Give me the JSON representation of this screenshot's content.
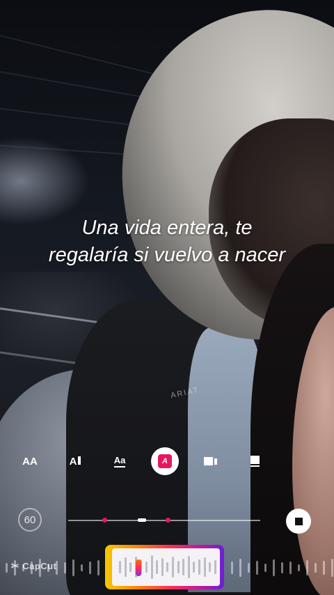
{
  "lyrics": {
    "line1": "Una vida entera, te",
    "line2": "regalaría si vuelvo a nacer"
  },
  "background": {
    "print_text": "ARIAT"
  },
  "toolbar": {
    "items": [
      {
        "id": "text-size",
        "label": "AA",
        "icon": "text-size-icon"
      },
      {
        "id": "text-style",
        "label": "A",
        "icon": "text-style-icon"
      },
      {
        "id": "text-underline",
        "label": "Aa",
        "icon": "text-underline-icon"
      },
      {
        "id": "text-color",
        "label": "A",
        "icon": "text-color-icon",
        "active": true
      },
      {
        "id": "background-style",
        "icon": "background-style-icon"
      },
      {
        "id": "placement",
        "icon": "placement-icon"
      }
    ],
    "accent_color": "#e8175d"
  },
  "timeline": {
    "speed_label": "60",
    "stop_icon": "stop-icon"
  },
  "scrubber": {
    "gradient_colors": [
      "#f7c900",
      "#ff8a00",
      "#ff2d55",
      "#c2189b",
      "#6a20d8"
    ]
  },
  "watermark": {
    "text": "CapCut"
  }
}
